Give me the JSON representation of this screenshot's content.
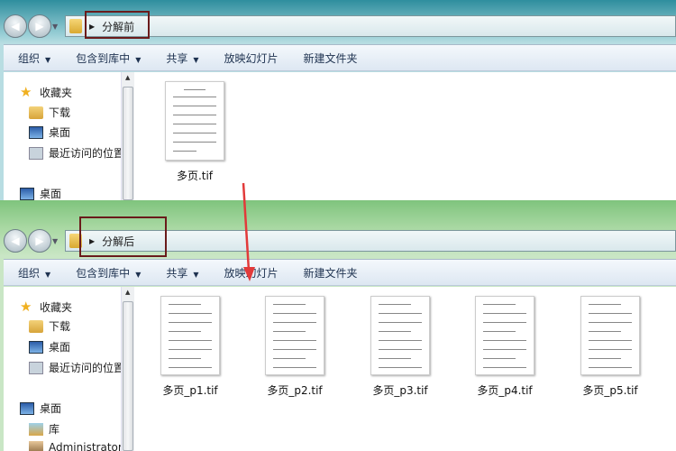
{
  "before": {
    "path": "分解前",
    "toolbar": [
      "组织",
      "包含到库中",
      "共享",
      "放映幻灯片",
      "新建文件夹"
    ],
    "sidebar": [
      "收藏夹",
      "下载",
      "桌面",
      "最近访问的位置",
      "桌面"
    ],
    "files": [
      "多页.tif"
    ]
  },
  "after": {
    "path": "分解后",
    "toolbar": [
      "组织",
      "包含到库中",
      "共享",
      "放映幻灯片",
      "新建文件夹"
    ],
    "sidebar": [
      "收藏夹",
      "下载",
      "桌面",
      "最近访问的位置",
      "桌面",
      "库",
      "Administrator"
    ],
    "files": [
      "多页_p1.tif",
      "多页_p2.tif",
      "多页_p3.tif",
      "多页_p4.tif",
      "多页_p5.tif"
    ]
  },
  "colors": {
    "highlight": "#6a1b1b",
    "arrow": "#e23a3a"
  }
}
